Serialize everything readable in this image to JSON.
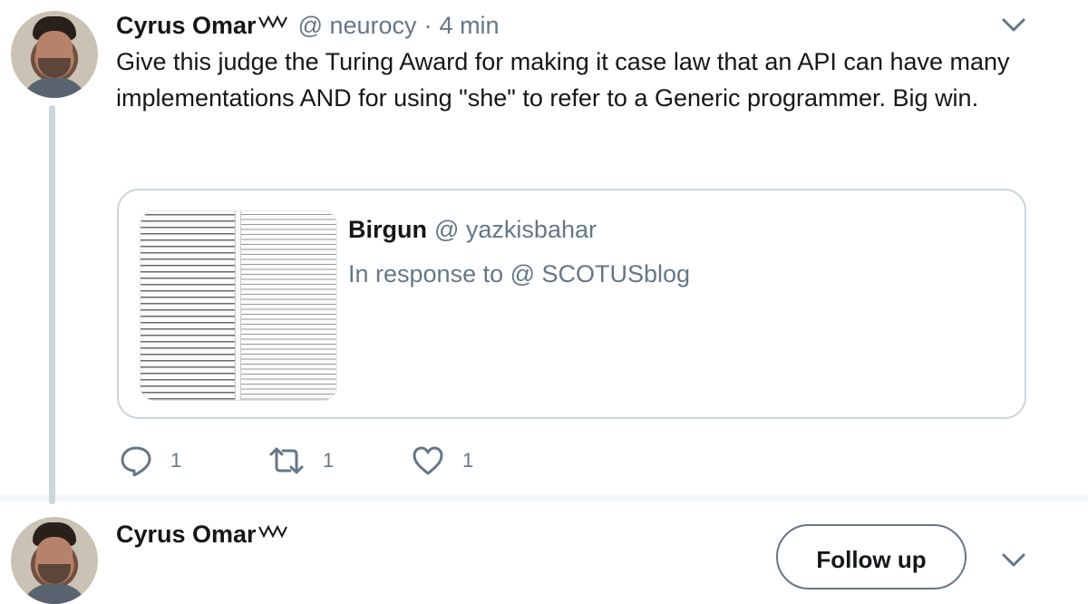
{
  "tweet": {
    "author_name": "Cyrus Omar",
    "handle": "@ neurocy",
    "separator": "·",
    "time": "4 min",
    "text": "Give this judge the Turing Award for making it case law that an API can have many implementations AND for using \"she\" to refer to a Generic programmer. Big win.",
    "quoted": {
      "author_name": "Birgun",
      "handle": "@ yazkisbahar",
      "reply_context": "In response to @ SCOTUSblog"
    },
    "actions": {
      "reply_count": "1",
      "retweet_count": "1",
      "like_count": "1"
    }
  },
  "next_tweet": {
    "author_name": "Cyrus Omar",
    "follow_label": "Follow up"
  },
  "icons": {
    "caret": "chevron-down-icon",
    "reply": "reply-icon",
    "retweet": "retweet-icon",
    "like": "heart-icon",
    "squiggle": "squiggle-icon"
  },
  "colors": {
    "text": "#14171a",
    "secondary": "#657786",
    "border": "#ccd6dd",
    "thread_line": "#ccd6dd"
  }
}
